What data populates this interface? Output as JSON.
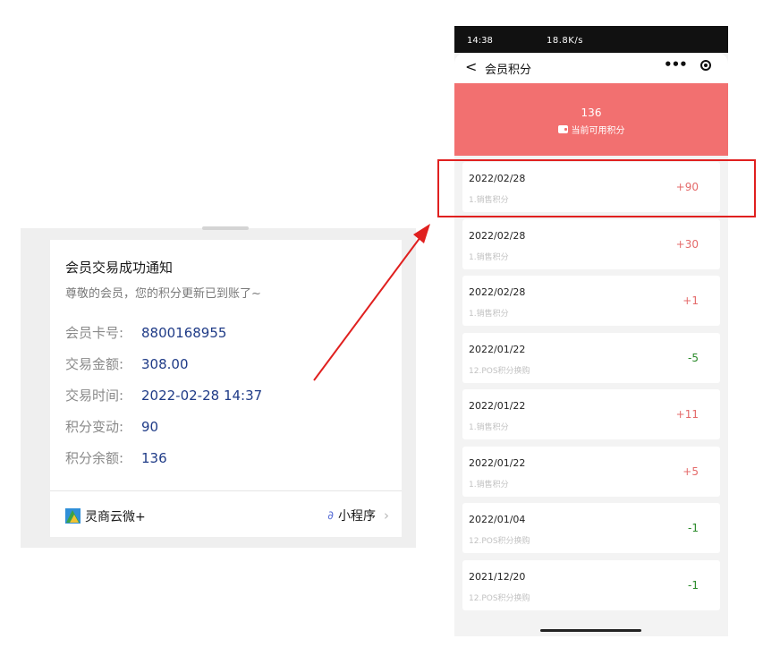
{
  "notification": {
    "title": "会员交易成功通知",
    "subtitle": "尊敬的会员，您的积分更新已到账了~",
    "fields": [
      {
        "label": "会员卡号:",
        "value": "8800168955"
      },
      {
        "label": "交易金额:",
        "value": "308.00"
      },
      {
        "label": "交易时间:",
        "value": "2022-02-28 14:37"
      },
      {
        "label": "积分变动:",
        "value": "90"
      },
      {
        "label": "积分余额:",
        "value": "136"
      }
    ],
    "app_name": "灵商云微+",
    "mini_program_label": "小程序",
    "mini_program_icon": "link-icon",
    "chevron_icon": "chevron-right-icon"
  },
  "status_bar": {
    "time": "14:38",
    "right": "18.8K/s"
  },
  "nav": {
    "back_icon": "chevron-left-icon",
    "title": "会员积分",
    "more_icon": "more-dots-icon",
    "close_icon": "target-close-icon"
  },
  "banner": {
    "value": "136",
    "label": "当前可用积分",
    "icon": "wallet-icon",
    "color": "#f27070"
  },
  "records": [
    {
      "date": "2022/02/28",
      "desc": "1.销售积分",
      "points": "+90"
    },
    {
      "date": "2022/02/28",
      "desc": "1.销售积分",
      "points": "+30"
    },
    {
      "date": "2022/02/28",
      "desc": "1.销售积分",
      "points": "+1"
    },
    {
      "date": "2022/01/22",
      "desc": "12.POS积分换购",
      "points": "-5"
    },
    {
      "date": "2022/01/22",
      "desc": "1.销售积分",
      "points": "+11"
    },
    {
      "date": "2022/01/22",
      "desc": "1.销售积分",
      "points": "+5"
    },
    {
      "date": "2022/01/04",
      "desc": "12.POS积分换购",
      "points": "-1"
    },
    {
      "date": "2021/12/20",
      "desc": "12.POS积分换购",
      "points": "-1"
    }
  ],
  "colors": {
    "positive": "#e46a6a",
    "negative": "#2a8a2a",
    "annotation": "#e0201f"
  }
}
